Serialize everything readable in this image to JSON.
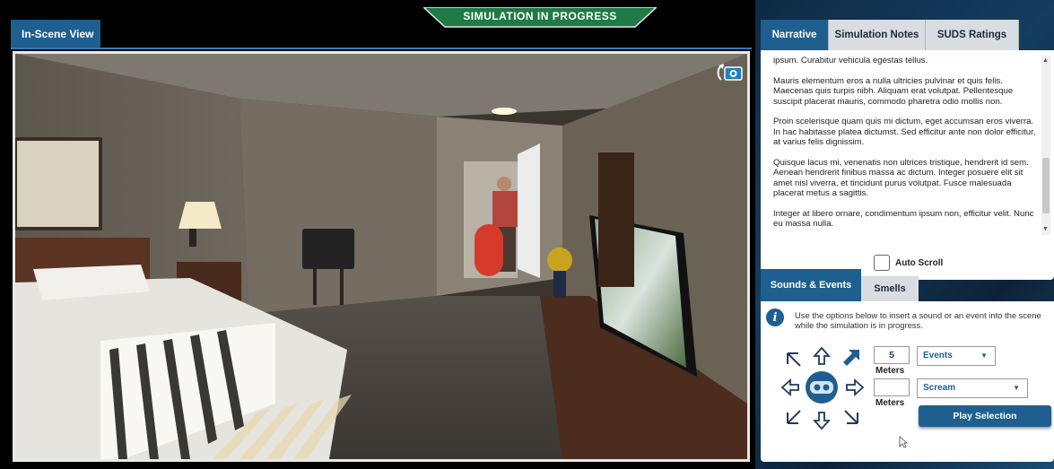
{
  "scene": {
    "tab_label": "In-Scene View",
    "banner": "SIMULATION IN PROGRESS",
    "camera_icon": "camera-rotate-icon"
  },
  "narrative": {
    "tabs": [
      {
        "label": "Narrative",
        "active": true
      },
      {
        "label": "Simulation Notes",
        "active": false
      },
      {
        "label": "SUDS Ratings",
        "active": false
      }
    ],
    "paragraphs": [
      "ipsum. Curabitur vehicula egestas tellus.",
      "Mauris elementum eros a nulla ultricies pulvinar et quis felis. Maecenas quis turpis nibh. Aliquam erat volutpat. Pellentesque suscipit placerat mauris, commodo pharetra odio mollis non.",
      "Proin scelerisque quam quis mi dictum, eget accumsan eros viverra. In hac habitasse platea dictumst. Sed efficitur ante non dolor efficitur, at varius felis dignissim.",
      "Quisque lacus mi, venenatis non ultrices tristique, hendrerit id sem. Aenean hendrerit finibus massa ac dictum. Integer posuere elit sit amet nisl viverra, et tincidunt purus volutpat. Fusce malesuada placerat metus a sagittis.",
      "Integer at libero ornare, condimentum ipsum non, efficitur velit. Nunc eu massa nulla."
    ],
    "auto_scroll_label": "Auto Scroll",
    "auto_scroll_checked": false
  },
  "sounds": {
    "tabs": [
      {
        "label": "Sounds & Events",
        "active": true
      },
      {
        "label": "Smells",
        "active": false
      }
    ],
    "info": "Use the options below to insert a sound or an event into the scene while the simulation is in progress.",
    "row1": {
      "distance": "5",
      "unit": "Meters",
      "select": "Events"
    },
    "row2": {
      "distance": "",
      "unit": "Meters",
      "select": "Scream"
    },
    "play_label": "Play Selection"
  },
  "colors": {
    "accent": "#1e5f8f",
    "banner": "#1f7a45"
  }
}
